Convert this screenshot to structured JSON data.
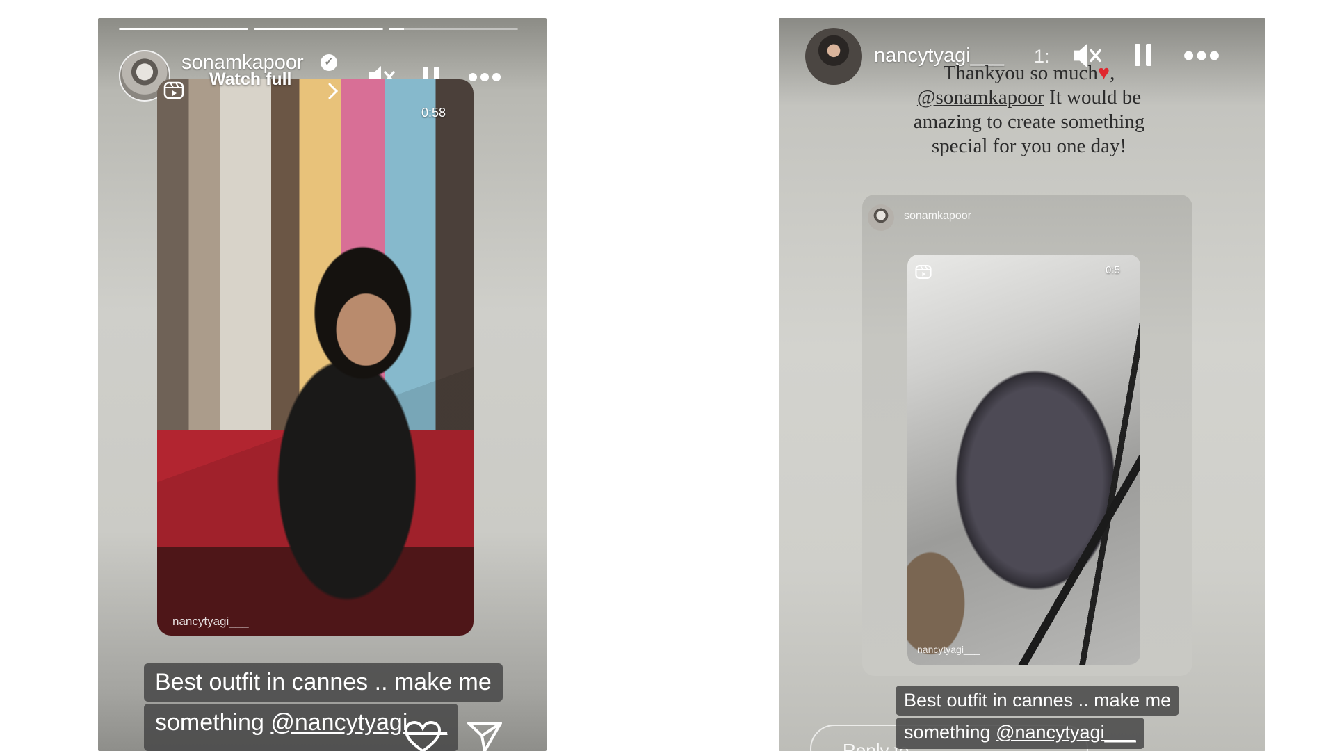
{
  "left_story": {
    "username": "sonamkapoor",
    "verified_icon": "verified-badge-icon",
    "progress": [
      1.0,
      1.0,
      0.12
    ],
    "watch_full_label": "Watch full",
    "duration": "0:58",
    "video_watermark": "nancytyagi___",
    "caption_line1": "Best outfit in cannes .. make me",
    "caption_line2_prefix": "something ",
    "caption_mention": "@nancytyagi___",
    "icons": [
      "mute-icon",
      "pause-icon",
      "more-icon",
      "reel-icon",
      "chevron-right-icon",
      "heart-icon",
      "send-icon"
    ]
  },
  "right_story": {
    "username": "nancytyagi___",
    "time_ago": "1:",
    "quote_line1": "Thankyou so much",
    "quote_heart": "♥",
    "quote_line1_end": ",",
    "quote_mention": "@sonamkapoor",
    "quote_rest": " It would be amazing to create something special for you one day!",
    "shared_username": "sonamkapoor",
    "shared_duration": "0:5",
    "shared_watermark": "nancytyagi___",
    "caption_line1": "Best outfit in cannes .. make me",
    "caption_line2_prefix": "something ",
    "caption_mention": "@nancytyagi___",
    "reply_placeholder": "Reply to",
    "icons": [
      "mute-icon",
      "pause-icon",
      "more-icon",
      "reel-icon"
    ]
  },
  "colors": {
    "heart": "#e0262e",
    "overlay_text": "#ffffff"
  }
}
